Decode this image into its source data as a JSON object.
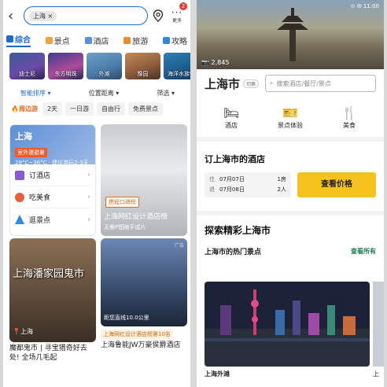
{
  "left": {
    "search_chip": "上海 ×",
    "more_label": "更多",
    "notif_count": "2",
    "categories": [
      "综合",
      "景点",
      "酒店",
      "旅游",
      "攻略"
    ],
    "thumbs": [
      "迪士尼",
      "东方明珠",
      "外滩",
      "豫园",
      "海洋水族馆"
    ],
    "filters": [
      "智能排序 ▾",
      "位置距离 ▾",
      "筛选 ▾"
    ],
    "tags": [
      "周边游",
      "2天",
      "一日游",
      "自由行",
      "免费景点"
    ],
    "city_card": {
      "name": "上海",
      "hot_tag": "室外漫避暑",
      "weather": "29°C~36°C · 建议游玩2-3天",
      "items": [
        "订酒店",
        "吃美食",
        "逛景点"
      ]
    },
    "hotel_card": {
      "rank_pill": "携程口碑榜",
      "caption": "上海网红设计酒店榜",
      "sub": "无需P图随手成片"
    },
    "ghost_card": {
      "overlay": "上海潘家园鬼市",
      "location": "上海",
      "caption": "魔都鬼市 | 寻宝猎奇好去处! 全场几毛起"
    },
    "jw_card": {
      "ad": "广告",
      "distance": "距您直线10.0公里",
      "rank_tag": "上海网红设计酒店榜第10名",
      "caption": "上海鲁能JW万豪侯爵酒店"
    }
  },
  "right": {
    "status": "⊙ ✉ 11:00",
    "photo_count": "2,845",
    "city": "上海市",
    "switch": "切换",
    "search_placeholder": "搜索酒店/餐厅/景点",
    "options": [
      "酒店",
      "景点体验",
      "美食"
    ],
    "book_title": "订上海市的酒店",
    "checkin_label": "住",
    "checkin": "07月07日",
    "checkout_label": "退",
    "checkout": "07月08日",
    "rooms": "1房",
    "guests": "2人",
    "price_button": "查看价格",
    "explore_title": "探索精彩上海市",
    "hot_title": "上海市的热门景点",
    "see_all": "查看所有",
    "attraction": "上海外滩",
    "attraction2": "上"
  }
}
